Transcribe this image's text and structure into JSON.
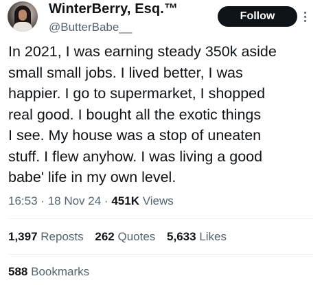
{
  "author": {
    "display_name": "WinterBerry, Esq.™",
    "handle": "@ButterBabe__",
    "follow_label": "Follow"
  },
  "tweet": {
    "lines": [
      "In 2021, I was earning steady 350k aside",
      "small small jobs. I lived better, I was",
      "happier. I go to supermarket, I shopped",
      "real good. I bought all the exotic things",
      "I see. My house was a stop of uneaten",
      "stuff. I flew anyhow. I was living a good",
      "babe' life in my own level."
    ]
  },
  "meta": {
    "time": "16:53",
    "date": "18 Nov 24",
    "views_count": "451K",
    "views_label": "Views",
    "separator": "·"
  },
  "stats": {
    "reposts_count": "1,397",
    "reposts_label": "Reposts",
    "quotes_count": "262",
    "quotes_label": "Quotes",
    "likes_count": "5,633",
    "likes_label": "Likes",
    "bookmarks_count": "588",
    "bookmarks_label": "Bookmarks"
  },
  "icons": {
    "more": "more-vertical-icon"
  },
  "colors": {
    "text_primary": "#0f1419",
    "text_secondary": "#536471",
    "button_bg": "#0f1419",
    "divider": "#eff3f4"
  }
}
